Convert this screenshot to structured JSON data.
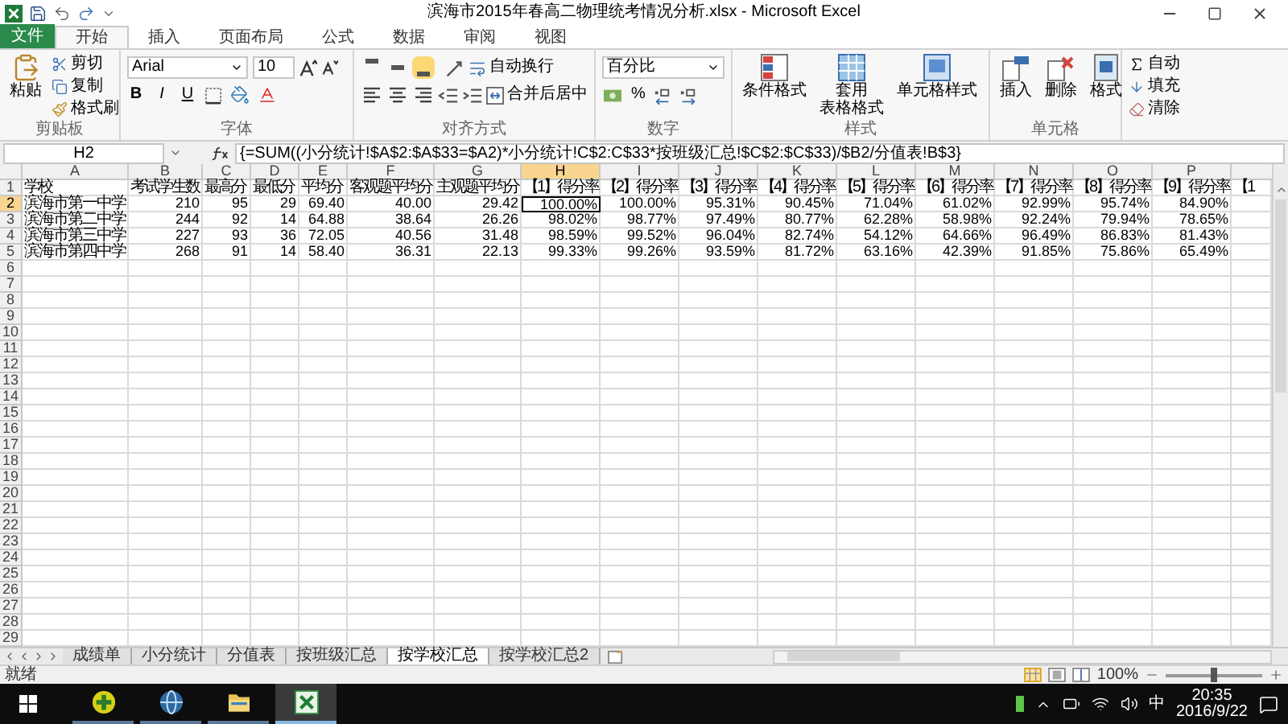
{
  "window": {
    "title": "滨海市2015年春高二物理统考情况分析.xlsx - Microsoft Excel"
  },
  "ribbon_tabs": [
    {
      "label": "文件",
      "kind": "file",
      "selected": false
    },
    {
      "label": "开始",
      "kind": "tab",
      "selected": true
    },
    {
      "label": "插入",
      "kind": "tab",
      "selected": false
    },
    {
      "label": "页面布局",
      "kind": "tab",
      "selected": false
    },
    {
      "label": "公式",
      "kind": "tab",
      "selected": false
    },
    {
      "label": "数据",
      "kind": "tab",
      "selected": false
    },
    {
      "label": "审阅",
      "kind": "tab",
      "selected": false
    },
    {
      "label": "视图",
      "kind": "tab",
      "selected": false
    }
  ],
  "ribbon": {
    "clipboard": {
      "label": "剪贴板",
      "paste": "粘贴",
      "cut": "剪切",
      "copy": "复制",
      "painter": "格式刷"
    },
    "font": {
      "label": "字体",
      "name": "Arial",
      "size": "10",
      "bold": "B",
      "italic": "I",
      "underline": "U"
    },
    "alignment": {
      "label": "对齐方式",
      "valign": [
        {
          "selected": false
        },
        {
          "selected": false
        },
        {
          "selected": true
        }
      ],
      "wrap": "自动换行",
      "merge": "合并后居中"
    },
    "number": {
      "label": "数字",
      "format": "百分比",
      "percent": "%"
    },
    "styles": {
      "label": "样式",
      "conditional": "条件格式",
      "table_format": [
        "套用",
        "表格格式"
      ],
      "cell_style": "单元格样式"
    },
    "cells": {
      "label": "单元格",
      "insert": "插入",
      "delete": "删除",
      "format": "格式"
    },
    "editing": {
      "autosum": "自动",
      "fill": "填充",
      "clear": "清除"
    }
  },
  "formula_bar": {
    "cell_ref": "H2",
    "formula": "{=SUM((小分统计!$A$2:$A$33=$A2)*小分统计!C$2:C$33*按班级汇总!$C$2:$C$33)/$B2/分值表!B$3}"
  },
  "sheet": {
    "columns": [
      {
        "label": "A",
        "selected": false
      },
      {
        "label": "B",
        "selected": false
      },
      {
        "label": "C",
        "selected": false
      },
      {
        "label": "D",
        "selected": false
      },
      {
        "label": "E",
        "selected": false
      },
      {
        "label": "F",
        "selected": false
      },
      {
        "label": "G",
        "selected": false
      },
      {
        "label": "H",
        "selected": true
      },
      {
        "label": "I",
        "selected": false
      },
      {
        "label": "J",
        "selected": false
      },
      {
        "label": "K",
        "selected": false
      },
      {
        "label": "L",
        "selected": false
      },
      {
        "label": "M",
        "selected": false
      },
      {
        "label": "N",
        "selected": false
      },
      {
        "label": "O",
        "selected": false
      },
      {
        "label": "P",
        "selected": false
      }
    ],
    "rows": [
      {
        "number": "1",
        "kind": "header",
        "selected": false,
        "cells": [
          "学校",
          "考试学生数",
          "最高分",
          "最低分",
          "平均分",
          "客观题平均分",
          "主观题平均分",
          "【1】得分率",
          "【2】得分率",
          "【3】得分率",
          "【4】得分率",
          "【5】得分率",
          "【6】得分率",
          "【7】得分率",
          "【8】得分率",
          "【9】得分率",
          "【1"
        ]
      },
      {
        "number": "2",
        "kind": "data",
        "selected": true,
        "cells": [
          "滨海市第一中学",
          "210",
          "95",
          "29",
          "69.40",
          "40.00",
          "29.42",
          "100.00%",
          "100.00%",
          "95.31%",
          "90.45%",
          "71.04%",
          "61.02%",
          "92.99%",
          "95.74%",
          "84.90%"
        ]
      },
      {
        "number": "3",
        "kind": "data",
        "selected": false,
        "cells": [
          "滨海市第二中学",
          "244",
          "92",
          "14",
          "64.88",
          "38.64",
          "26.26",
          "98.02%",
          "98.77%",
          "97.49%",
          "80.77%",
          "62.28%",
          "58.98%",
          "92.24%",
          "79.94%",
          "78.65%"
        ]
      },
      {
        "number": "4",
        "kind": "data",
        "selected": false,
        "cells": [
          "滨海市第三中学",
          "227",
          "93",
          "36",
          "72.05",
          "40.56",
          "31.48",
          "98.59%",
          "99.52%",
          "96.04%",
          "82.74%",
          "54.12%",
          "64.66%",
          "96.49%",
          "86.83%",
          "81.43%"
        ]
      },
      {
        "number": "5",
        "kind": "data",
        "selected": false,
        "cells": [
          "滨海市第四中学",
          "268",
          "91",
          "14",
          "58.40",
          "36.31",
          "22.13",
          "99.33%",
          "99.26%",
          "93.59%",
          "81.72%",
          "63.16%",
          "42.39%",
          "91.85%",
          "75.86%",
          "65.49%"
        ]
      },
      {
        "number": "6",
        "kind": "data",
        "selected": false
      },
      {
        "number": "7",
        "kind": "data",
        "selected": false
      },
      {
        "number": "8",
        "kind": "data",
        "selected": false
      },
      {
        "number": "9",
        "kind": "data",
        "selected": false
      },
      {
        "number": "10",
        "kind": "data",
        "selected": false
      },
      {
        "number": "11",
        "kind": "data",
        "selected": false
      },
      {
        "number": "12",
        "kind": "data",
        "selected": false
      },
      {
        "number": "13",
        "kind": "data",
        "selected": false
      },
      {
        "number": "14",
        "kind": "data",
        "selected": false
      },
      {
        "number": "15",
        "kind": "data",
        "selected": false
      },
      {
        "number": "16",
        "kind": "data",
        "selected": false
      },
      {
        "number": "17",
        "kind": "data",
        "selected": false
      },
      {
        "number": "18",
        "kind": "data",
        "selected": false
      },
      {
        "number": "19",
        "kind": "data",
        "selected": false
      },
      {
        "number": "20",
        "kind": "data",
        "selected": false
      },
      {
        "number": "21",
        "kind": "data",
        "selected": false
      },
      {
        "number": "22",
        "kind": "data",
        "selected": false
      },
      {
        "number": "23",
        "kind": "data",
        "selected": false
      },
      {
        "number": "24",
        "kind": "data",
        "selected": false
      },
      {
        "number": "25",
        "kind": "data",
        "selected": false
      },
      {
        "number": "26",
        "kind": "data",
        "selected": false
      },
      {
        "number": "27",
        "kind": "data",
        "selected": false
      },
      {
        "number": "28",
        "kind": "data",
        "selected": false
      },
      {
        "number": "29",
        "kind": "data",
        "selected": false
      }
    ]
  },
  "sheet_tabs": [
    {
      "label": "成绩单",
      "selected": false
    },
    {
      "label": "小分统计",
      "selected": false
    },
    {
      "label": "分值表",
      "selected": false
    },
    {
      "label": "按班级汇总",
      "selected": false
    },
    {
      "label": "按学校汇总",
      "selected": true
    },
    {
      "label": "按学校汇总2",
      "selected": false
    }
  ],
  "status_bar": {
    "text": "就绪",
    "zoom": "100%",
    "zoom_slider": {
      "level": 0.5
    }
  },
  "taskbar": {
    "apps": [
      {
        "kind": "clover",
        "selected": false
      },
      {
        "kind": "globe",
        "selected": false
      },
      {
        "kind": "folder",
        "selected": false
      },
      {
        "kind": "spreadsheet",
        "selected": true
      }
    ],
    "ime": "中",
    "time": "20:35",
    "date": "2016/9/22"
  }
}
